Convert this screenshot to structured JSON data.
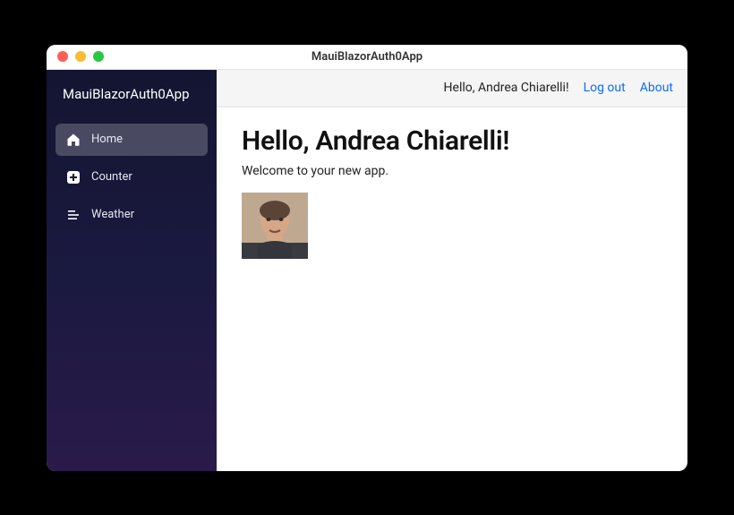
{
  "window": {
    "title": "MauiBlazorAuth0App"
  },
  "sidebar": {
    "brand": "MauiBlazorAuth0App",
    "items": [
      {
        "label": "Home",
        "icon": "home-icon",
        "active": true
      },
      {
        "label": "Counter",
        "icon": "plus-icon",
        "active": false
      },
      {
        "label": "Weather",
        "icon": "list-icon",
        "active": false
      }
    ]
  },
  "topbar": {
    "greeting": "Hello, Andrea Chiarelli!",
    "logout": "Log out",
    "about": "About"
  },
  "page": {
    "heading": "Hello, Andrea Chiarelli!",
    "welcome": "Welcome to your new app."
  }
}
